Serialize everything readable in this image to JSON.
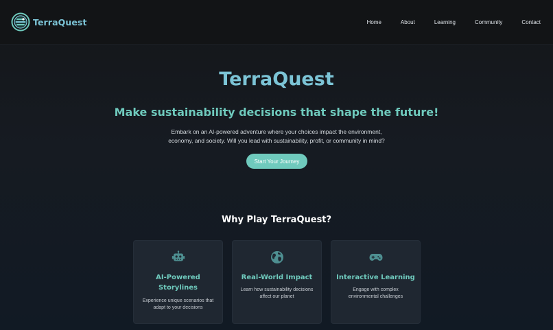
{
  "brand": {
    "name": "TerraQuest"
  },
  "nav": {
    "items": [
      {
        "label": "Home"
      },
      {
        "label": "About"
      },
      {
        "label": "Learning"
      },
      {
        "label": "Community"
      },
      {
        "label": "Contact"
      }
    ]
  },
  "hero": {
    "title": "TerraQuest",
    "subtitle": "Make sustainability decisions that shape the future!",
    "description": "Embark on an AI-powered adventure where your choices impact the environment, economy, and society. Will you lead with sustainability, profit, or community in mind?",
    "cta_label": "Start Your Journey"
  },
  "features": {
    "heading": "Why Play TerraQuest?",
    "cards": [
      {
        "icon": "robot-icon",
        "title": "AI-Powered Storylines",
        "description": "Experience unique scenarios that adapt to your decisions"
      },
      {
        "icon": "globe-icon",
        "title": "Real-World Impact",
        "description": "Learn how sustainability decisions affect our planet"
      },
      {
        "icon": "gamepad-icon",
        "title": "Interactive Learning",
        "description": "Engage with complex environmental challenges"
      }
    ]
  },
  "colors": {
    "accent": "#6fcabd",
    "brand": "#7cc4d6",
    "background": "#141619",
    "card": "#1f2731"
  }
}
